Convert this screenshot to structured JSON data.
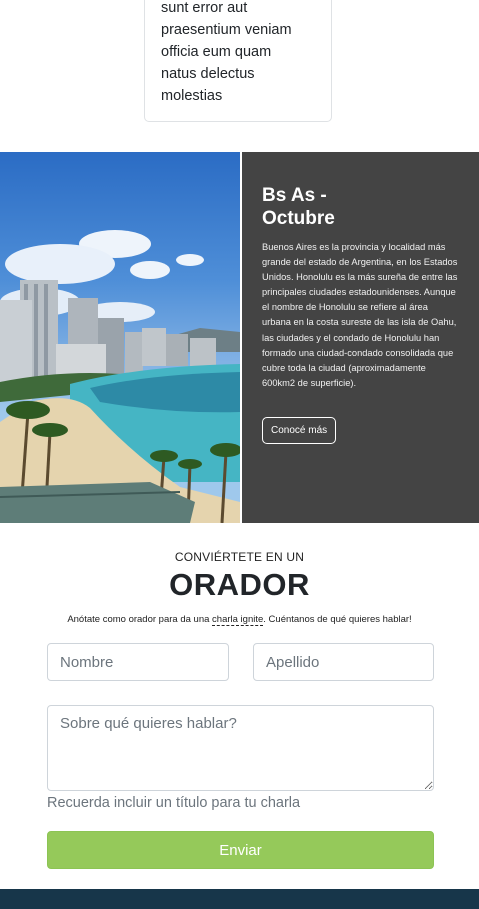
{
  "card": {
    "text": "sunt error aut\npraesentium veniam\nofficia eum quam\nnatus delectus\nmolestias"
  },
  "hero": {
    "image_alt": "Honolulu beach",
    "title": "Bs As -\nOctubre",
    "body": "Buenos Aires es la provincia y localidad más grande del estado de Argentina, en los Estados Unidos. Honolulu es la más sureña de entre las principales ciudades estadounidenses. Aunque el nombre de Honolulu se refiere al área urbana en la costa sureste de las isla de Oahu, las ciudades y el condado de Honolulu han formado una ciudad-condado consolidada que cubre toda la ciudad (aproximadamente 600km2 de superficie).",
    "button_label": "Conocé más"
  },
  "speaker": {
    "kicker": "CONVIÉRTETE EN UN",
    "title": "ORADOR",
    "intro_before": "Anótate como orador para da una ",
    "intro_link": "charla ignite",
    "intro_after": ". Cuéntanos de qué quieres hablar!",
    "first_name_placeholder": "Nombre",
    "last_name_placeholder": "Apellido",
    "topic_placeholder": "Sobre qué quieres hablar?",
    "hint": "Recuerda incluir un título para tu charla",
    "submit_label": "Enviar"
  },
  "colors": {
    "hero_panel": "#444444",
    "submit": "#95c95a",
    "footer": "#17364a"
  }
}
